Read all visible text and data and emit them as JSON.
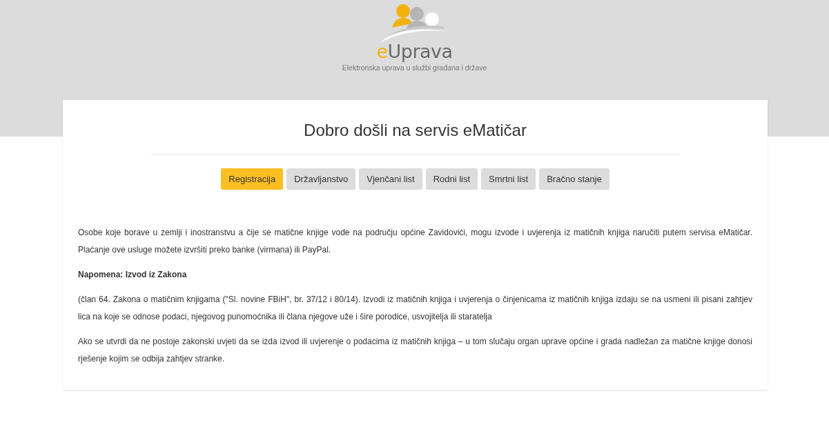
{
  "header": {
    "logo": {
      "accent": "e",
      "rest": "Uprava"
    },
    "tagline": "Elektronska uprava u službi građana i države"
  },
  "card": {
    "title": "Dobro došli na servis eMatičar",
    "tabs": [
      {
        "label": "Registracija",
        "selected": true
      },
      {
        "label": "Državljanstvo",
        "selected": false
      },
      {
        "label": "Vjenčani list",
        "selected": false
      },
      {
        "label": "Rodni list",
        "selected": false
      },
      {
        "label": "Smrtni list",
        "selected": false
      },
      {
        "label": "Bračno stanje",
        "selected": false
      }
    ],
    "paragraphs": [
      {
        "kind": "text",
        "text": "Osobe koje borave u zemlji i inostranstvu a čije se matične knjige vode na području općine Zavidovići, mogu izvode i uvjerenja iz matičnih knjiga naručiti putem servisa eMatičar. Plaćanje ove usluge možete izvršiti preko banke (virmana) ili PayPal."
      },
      {
        "kind": "heading",
        "text": "Napomena: Izvod iz Zakona"
      },
      {
        "kind": "text",
        "text": "(član 64. Zakona o matičnim knjigama (\"Sl. novine FBiH\", br. 37/12 i 80/14). Izvodi iz matičnih knjiga i uvjerenja o činjenicama iz matičnih knjiga izdaju se na usmeni ili pisani zahtjev lica na koje se odnose podaci, njegovog punomoćnika ili člana njegove uže i šire porodice, usvojitelja ili staratelja"
      },
      {
        "kind": "text",
        "text": "Ako se utvrdi da ne postoje zakonski uvjeti da se izda izvod ili uvjerenje o podacima iz matičnih knjiga – u tom slučaju organ uprave općine i grada nadležan za matične knjige donosi rješenje kojim se odbija zahtjev stranke."
      }
    ]
  }
}
